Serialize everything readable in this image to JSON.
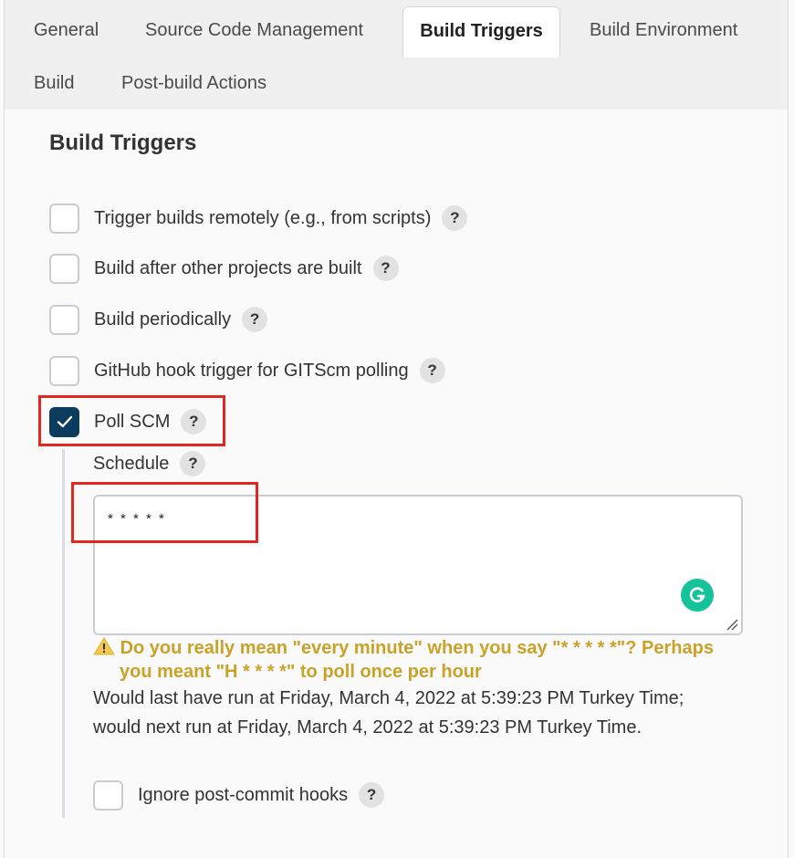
{
  "tabs": [
    {
      "label": "General",
      "active": false
    },
    {
      "label": "Source Code Management",
      "active": false
    },
    {
      "label": "Build Triggers",
      "active": true
    },
    {
      "label": "Build Environment",
      "active": false
    },
    {
      "label": "Build",
      "active": false
    },
    {
      "label": "Post-build Actions",
      "active": false
    }
  ],
  "section_title": "Build Triggers",
  "triggers": [
    {
      "label": "Trigger builds remotely (e.g., from scripts)",
      "checked": false
    },
    {
      "label": "Build after other projects are built",
      "checked": false
    },
    {
      "label": "Build periodically",
      "checked": false
    },
    {
      "label": "GitHub hook trigger for GITScm polling",
      "checked": false
    },
    {
      "label": "Poll SCM",
      "checked": true
    }
  ],
  "help_glyph": "?",
  "schedule": {
    "label": "Schedule",
    "value": "* * * * *",
    "warning_line1": "Do you really mean \"every minute\" when you say \"* * * * *\"? Perhaps",
    "warning_line2": "you meant \"H * * * *\" to poll once per hour",
    "info_line1": "Would last have run at Friday, March 4, 2022 at 5:39:23 PM Turkey Time;",
    "info_line2": "would next run at Friday, March 4, 2022 at 5:39:23 PM Turkey Time."
  },
  "ignore_post_commit": {
    "label": "Ignore post-commit hooks",
    "checked": false
  },
  "colors": {
    "accent": "#0b3c5d",
    "warning": "#c9a227",
    "highlight": "#e3261f",
    "grammarly": "#15c39a"
  }
}
